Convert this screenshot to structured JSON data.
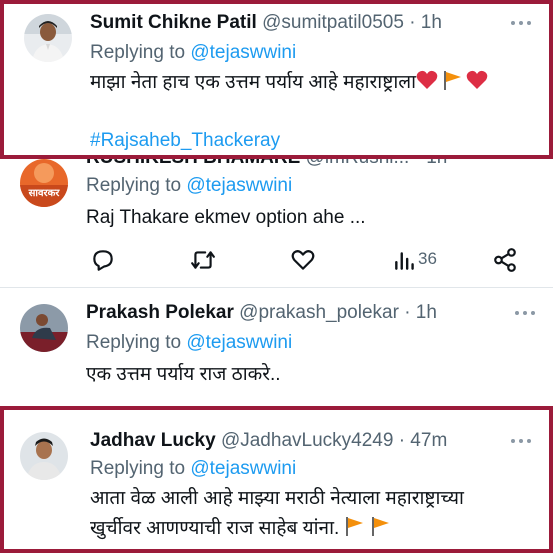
{
  "tweets": [
    {
      "name": "Sumit Chikne Patil",
      "handle": "@sumitpatil0505",
      "time": "· 1h",
      "replying_prefix": "Replying to",
      "replying_to": "@tejaswwini",
      "text": "माझा नेता हाच एक उत्तम पर्याय आहे महाराष्ट्राला",
      "emojis": "❤️🚩❤️",
      "hashtag": "#Rajsaheb_Thackeray"
    },
    {
      "name": "RUSHIKESH BHAMARE",
      "handle": "@imRushi...",
      "time": "· 1h",
      "avatar_text": "सावरकर",
      "replying_prefix": "Replying to",
      "replying_to": "@tejaswwini",
      "text": "Raj Thakare ekmev option ahe ...",
      "views": "36"
    },
    {
      "name": "Prakash Polekar",
      "handle": "@prakash_polekar",
      "time": "· 1h",
      "replying_prefix": "Replying to",
      "replying_to": "@tejaswwini",
      "text": "एक उत्तम पर्याय राज ठाकरे.."
    },
    {
      "name": "Jadhav Lucky",
      "handle": "@JadhavLucky4249",
      "time": "· 47m",
      "replying_prefix": "Replying to",
      "replying_to": "@tejaswwini",
      "text_line1": "आता वेळ आली आहे माझ्या मराठी  नेत्याला महाराष्ट्राच्या",
      "text_line2": "खुर्चीवर आणण्याची राज साहेब यांना.",
      "emojis": "🚩🚩"
    }
  ],
  "colors": {
    "frame": "#9b1b3a",
    "link": "#1d9bf0",
    "secondary_text": "#536471",
    "primary_text": "#0f1419"
  },
  "icons": [
    "more-icon",
    "reply-icon",
    "retweet-icon",
    "like-icon",
    "views-icon",
    "share-icon",
    "red-flag-emoji",
    "red-heart-emoji"
  ]
}
